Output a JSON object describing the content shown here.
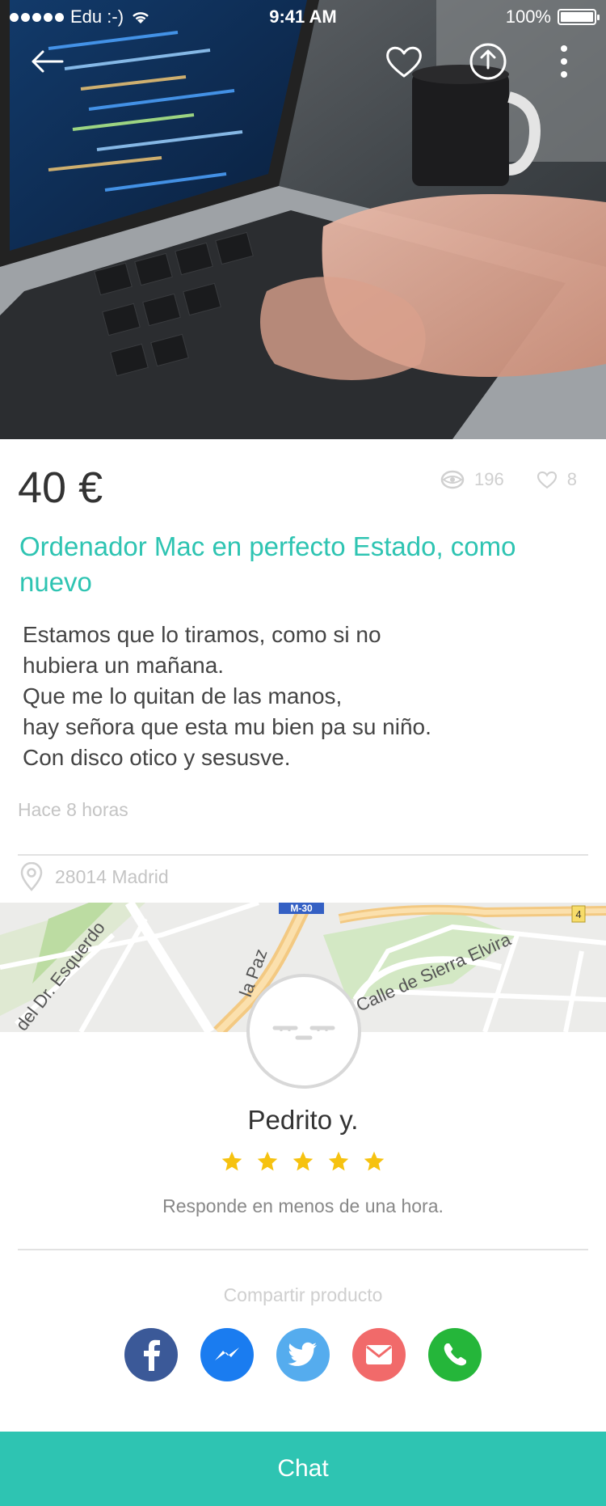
{
  "status_bar": {
    "carrier": "Edu :-)",
    "time": "9:41 AM",
    "battery": "100%"
  },
  "nav": {
    "back_icon": "back-arrow-icon",
    "favorite_icon": "heart-icon",
    "share_icon": "share-icon",
    "more_icon": "more-vertical-icon"
  },
  "product": {
    "price": "40 €",
    "views": "196",
    "likes": "8",
    "title": "Ordenador Mac en perfecto Estado, como nuevo",
    "description": [
      "Estamos que lo tiramos, como si no",
      "hubiera un mañana.",
      "Que me lo quitan de las manos,",
      "hay señora que esta mu bien pa su niño.",
      "Con disco otico y sesusve."
    ],
    "posted": "Hace 8 horas",
    "location": "28014 Madrid"
  },
  "map": {
    "labels": [
      "del Dr. Esquerdo",
      "la Paz",
      "Calle de Sierra Elvira",
      "M-30",
      "4"
    ]
  },
  "seller": {
    "name": "Pedrito y.",
    "rating": 5,
    "rating_max": 5,
    "response": "Responde en menos de una hora."
  },
  "share": {
    "label": "Compartir producto",
    "buttons": [
      {
        "name": "facebook",
        "color": "#3b5998",
        "icon": "facebook-icon"
      },
      {
        "name": "messenger",
        "color": "#1a7cf0",
        "icon": "messenger-icon"
      },
      {
        "name": "twitter",
        "color": "#55acee",
        "icon": "twitter-icon"
      },
      {
        "name": "email",
        "color": "#f16a6a",
        "icon": "mail-icon"
      },
      {
        "name": "whatsapp",
        "color": "#25b63a",
        "icon": "whatsapp-icon"
      }
    ]
  },
  "chat_button": "Chat",
  "colors": {
    "accent": "#2ec4b2",
    "star": "#f6c210"
  }
}
